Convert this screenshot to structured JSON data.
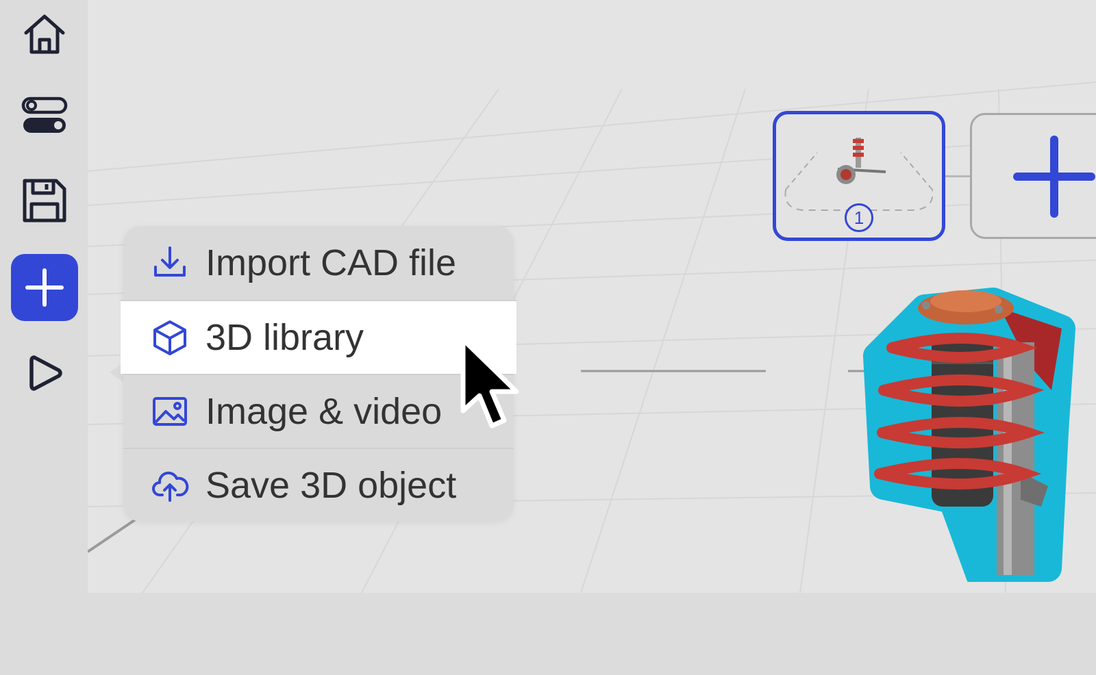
{
  "sidebar": {
    "items": [
      {
        "icon": "home-icon"
      },
      {
        "icon": "toggles-icon"
      },
      {
        "icon": "save-disk-icon"
      },
      {
        "icon": "plus-icon",
        "active": true
      },
      {
        "icon": "play-icon"
      }
    ]
  },
  "add_menu": {
    "items": [
      {
        "label": "Import CAD file",
        "icon": "download-icon"
      },
      {
        "label": "3D library",
        "icon": "cube-icon",
        "highlighted": true
      },
      {
        "label": "Image & video",
        "icon": "image-icon"
      },
      {
        "label": "Save 3D object",
        "icon": "cloud-upload-icon"
      }
    ]
  },
  "scenes": {
    "cards": [
      {
        "number": "1",
        "selected": true
      }
    ],
    "add_icon": "plus-icon"
  },
  "colors": {
    "accent": "#3347d6",
    "background": "#dcdcdc",
    "viewport": "#e4e4e4",
    "menu_bg": "#dadada",
    "highlight": "#ffffff",
    "model_outline": "#19b8d8",
    "model_spring": "#c83a34"
  }
}
